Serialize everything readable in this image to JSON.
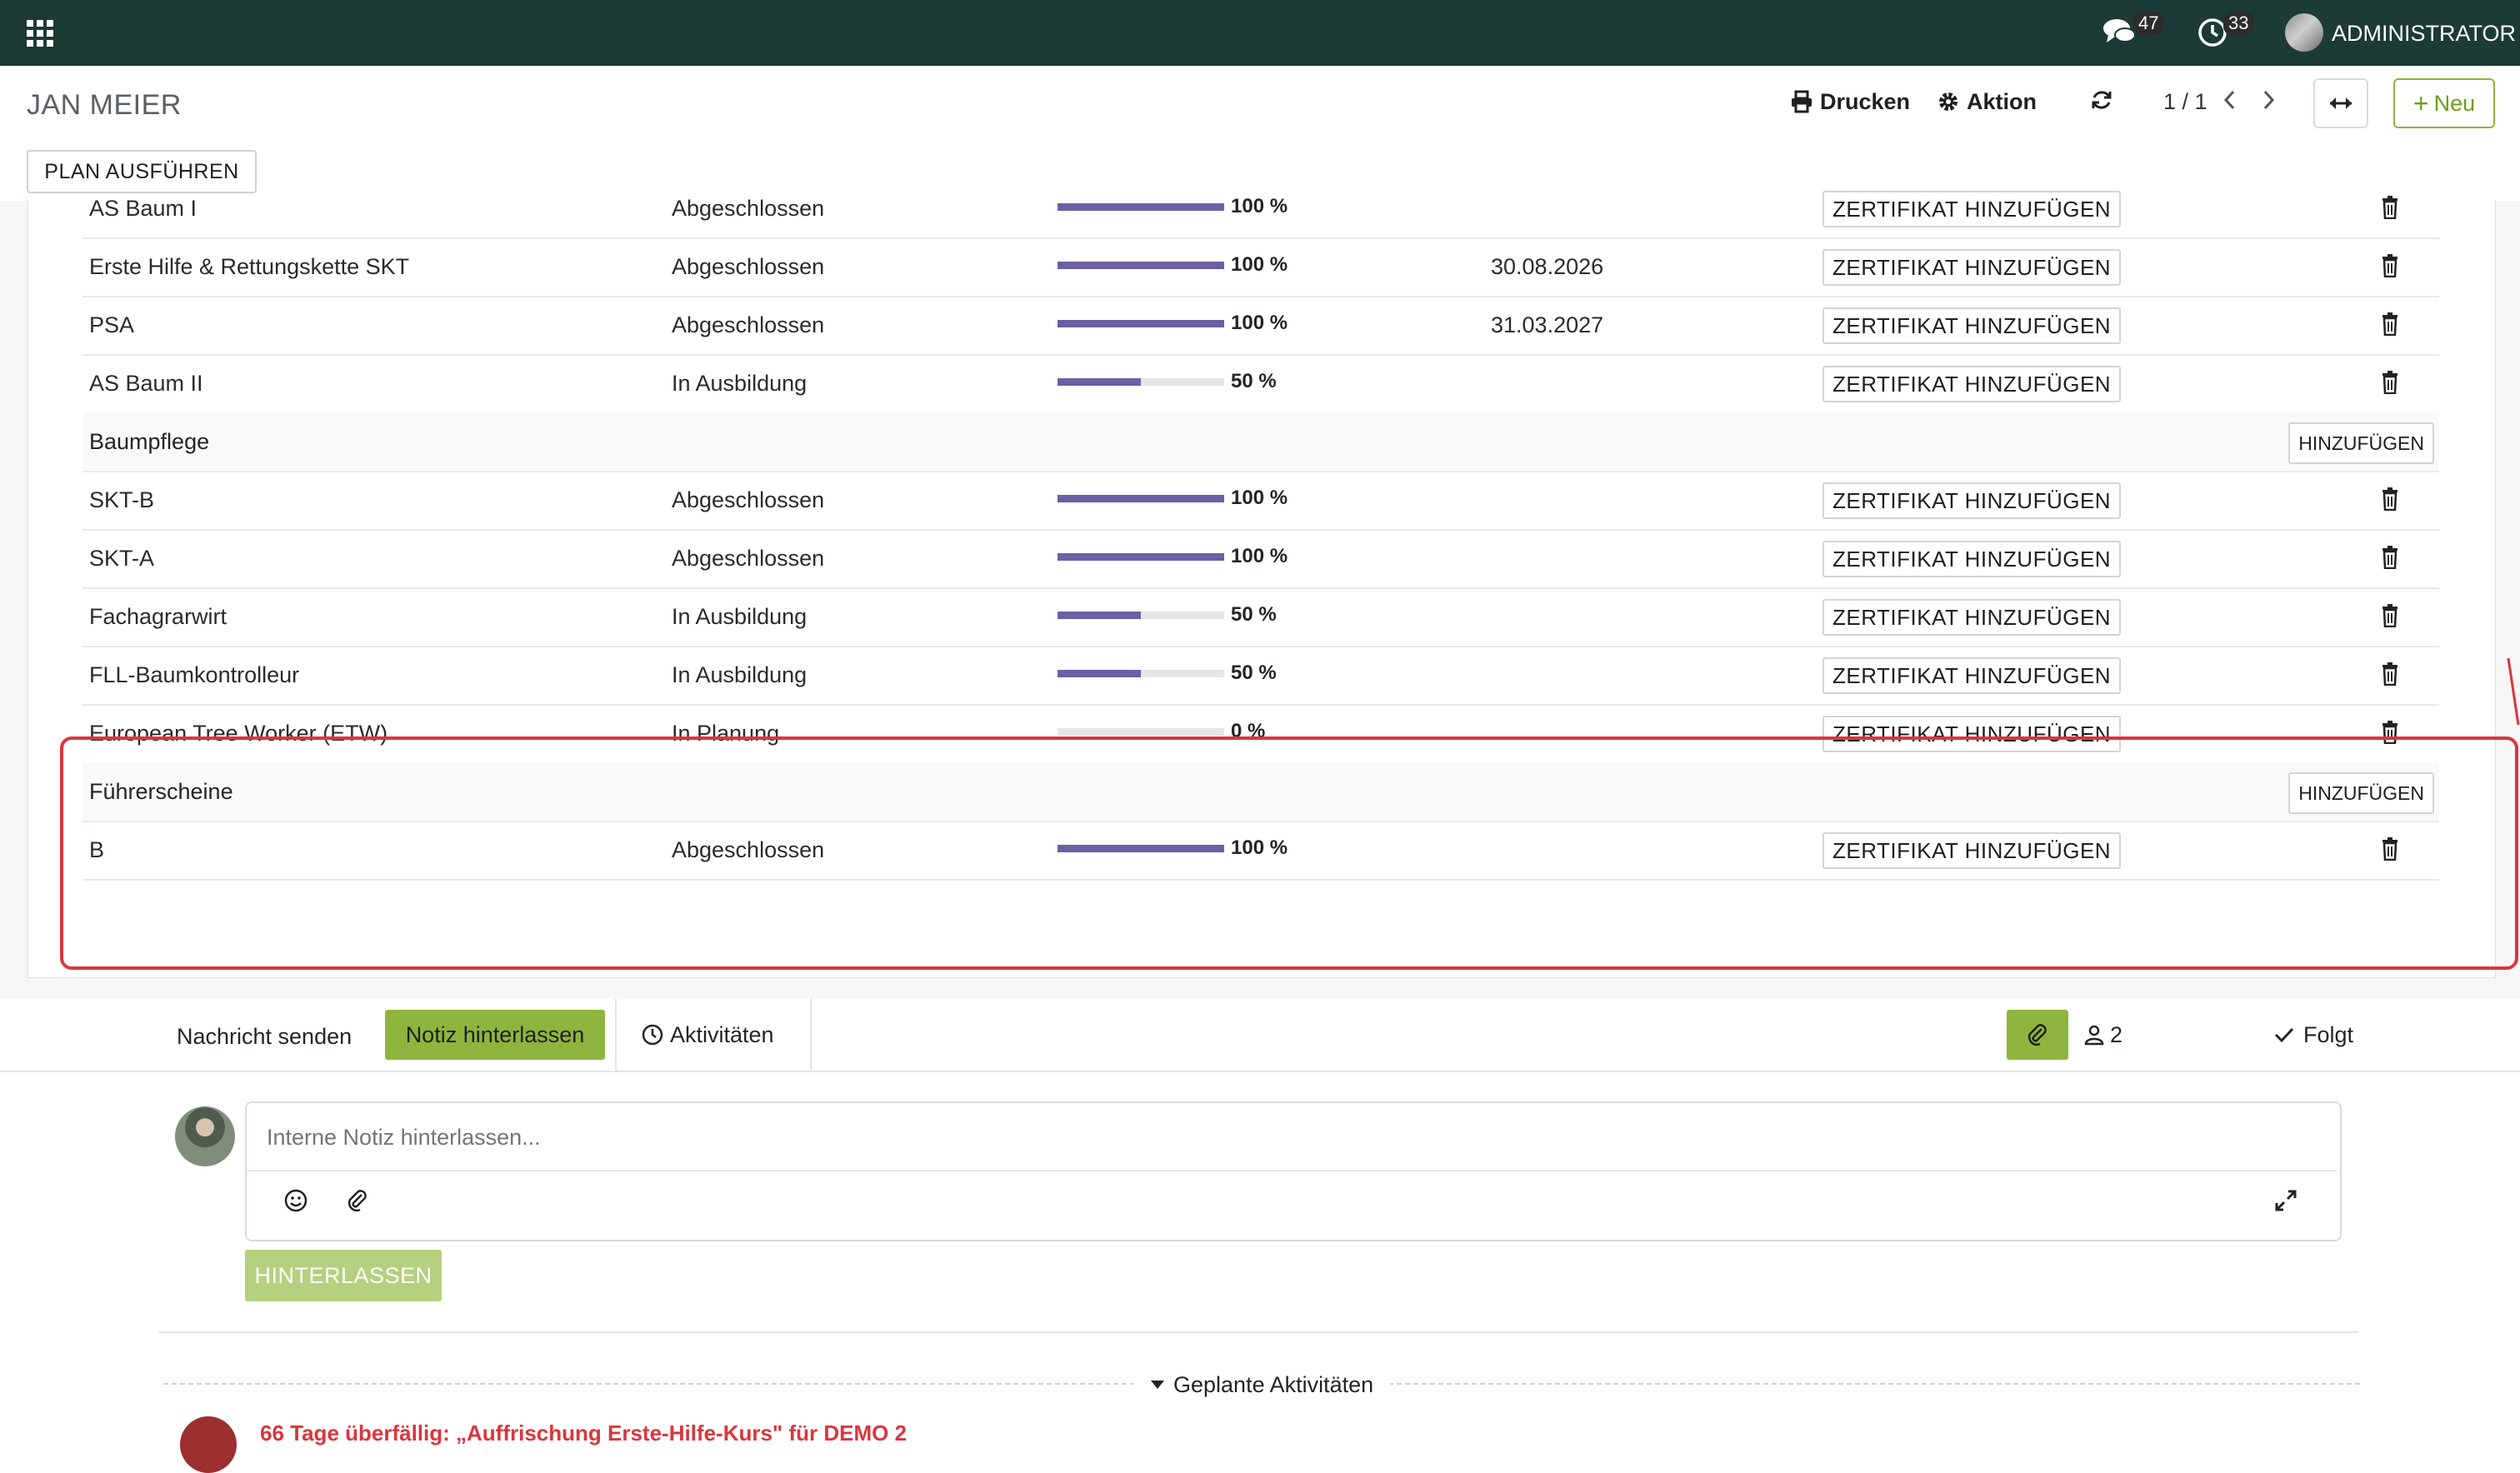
{
  "navbar": {
    "messages_count": "47",
    "activities_count": "33",
    "user_label": "ADMINISTRATOR"
  },
  "control_panel": {
    "record_title": "JAN MEIER",
    "print_label": "Drucken",
    "action_label": "Aktion",
    "pager": "1 / 1",
    "new_label": "Neu",
    "plan_button": "PLAN AUSFÜHREN"
  },
  "qualifications": {
    "cert_button_label": "ZERTIFIKAT HINZUFÜGEN",
    "add_label": "HINZUFÜGEN",
    "rows": [
      {
        "type": "item",
        "name": "AS Baum I",
        "status": "Abgeschlossen",
        "progress": 100,
        "pct": "100 %",
        "date": ""
      },
      {
        "type": "item",
        "name": "Erste Hilfe & Rettungskette SKT",
        "status": "Abgeschlossen",
        "progress": 100,
        "pct": "100 %",
        "date": "30.08.2026"
      },
      {
        "type": "item",
        "name": "PSA",
        "status": "Abgeschlossen",
        "progress": 100,
        "pct": "100 %",
        "date": "31.03.2027"
      },
      {
        "type": "item",
        "name": "AS Baum II",
        "status": "In Ausbildung",
        "progress": 50,
        "pct": "50 %",
        "date": ""
      },
      {
        "type": "section",
        "name": "Baumpflege"
      },
      {
        "type": "item",
        "name": "SKT-B",
        "status": "Abgeschlossen",
        "progress": 100,
        "pct": "100 %",
        "date": ""
      },
      {
        "type": "item",
        "name": "SKT-A",
        "status": "Abgeschlossen",
        "progress": 100,
        "pct": "100 %",
        "date": ""
      },
      {
        "type": "item",
        "name": "Fachagrarwirt",
        "status": "In Ausbildung",
        "progress": 50,
        "pct": "50 %",
        "date": ""
      },
      {
        "type": "item",
        "name": "FLL-Baumkontrolleur",
        "status": "In Ausbildung",
        "progress": 50,
        "pct": "50 %",
        "date": ""
      },
      {
        "type": "item",
        "name": "European Tree Worker (ETW)",
        "status": "In Planung",
        "progress": 0,
        "pct": "0 %",
        "date": ""
      },
      {
        "type": "section",
        "name": "Führerscheine"
      },
      {
        "type": "item",
        "name": "B",
        "status": "Abgeschlossen",
        "progress": 100,
        "pct": "100 %",
        "date": ""
      }
    ]
  },
  "chatter": {
    "send_message": "Nachricht senden",
    "log_note": "Notiz hinterlassen",
    "activities": "Aktivitäten",
    "followers_count": "2",
    "follow_status": "Folgt",
    "composer_placeholder": "Interne Notiz hinterlassen...",
    "submit_label": "HINTERLASSEN",
    "planned_activities": "Geplante Aktivitäten",
    "next_activity_text": "66 Tage überfällig: „Auffrischung Erste-Hilfe-Kurs\" für DEMO 2"
  },
  "colors": {
    "navbar": "#1c3a36",
    "progress": "#6c5fa3",
    "accent_green": "#8db53d",
    "highlight_red": "#d9363e"
  }
}
